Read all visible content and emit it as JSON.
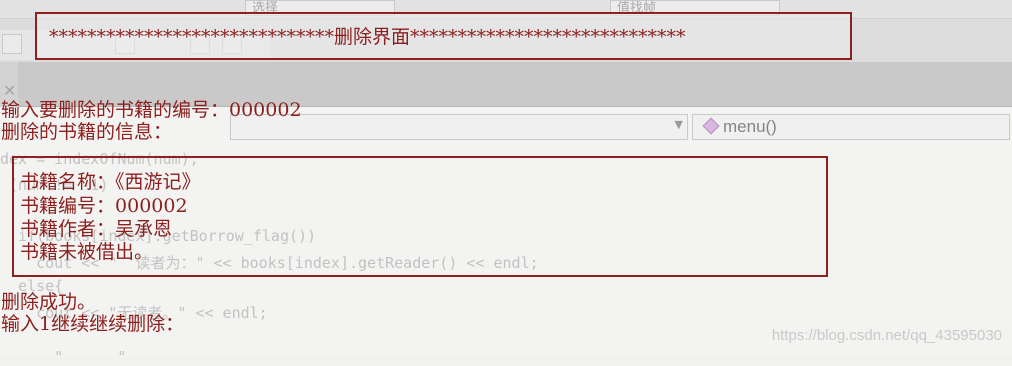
{
  "ide": {
    "faint_toolbar_left": "选择",
    "faint_toolbar_right": "值找帧",
    "method_combo": "menu()",
    "close_glyph": "✕",
    "faint_code": {
      "line1": "dex = indexOfNum(num);",
      "line2": " (num != -1)",
      "line3": "  if(books[index].getBorrow_flag())",
      "line4": "    cout << \"  读者为：\" << books[index].getReader() << endl;",
      "line5": "  else{",
      "line6": "    cout << \"无读者。\" << endl;",
      "line7": "      \"      \""
    }
  },
  "console": {
    "header": "******************************删除界面*****************************",
    "prompt_id": "输入要删除的书籍的编号：000002",
    "info_title": "删除的书籍的信息：",
    "book_name": " 书籍名称：《西游记》",
    "book_id": " 书籍编号：000002",
    "book_author": " 书籍作者：吴承恩",
    "book_status": " 书籍未被借出。",
    "success": "删除成功。",
    "continue_prompt": "输入1继续继续删除："
  },
  "watermark": "https://blog.csdn.net/qq_43595030"
}
